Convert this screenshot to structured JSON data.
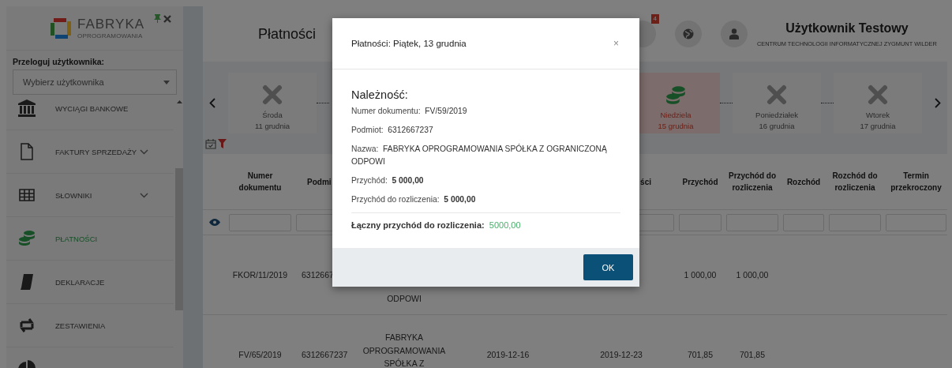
{
  "sidebar": {
    "logo": {
      "name": "FABRYKA",
      "tagline": "OPROGRAMOWANIA"
    },
    "switch_user": {
      "label": "Przeloguj użytkownika:",
      "placeholder": "Wybierz użytkownika"
    },
    "items": [
      {
        "kind": "bank",
        "label": "WYCIĄGI BANKOWE",
        "has_submenu": false,
        "selected": false
      },
      {
        "kind": "document",
        "label": "FAKTURY SPRZEDAŻY",
        "has_submenu": true,
        "selected": false
      },
      {
        "kind": "table",
        "label": "SŁOWNIKI",
        "has_submenu": true,
        "selected": false
      },
      {
        "kind": "coins",
        "label": "PŁATNOŚCI",
        "has_submenu": false,
        "selected": true
      },
      {
        "kind": "book",
        "label": "DEKLARACJE",
        "has_submenu": false,
        "selected": false
      },
      {
        "kind": "exchange",
        "label": "ZESTAWIENIA",
        "has_submenu": false,
        "selected": false
      },
      {
        "kind": "pie",
        "has_submenu": false,
        "selected": false
      }
    ]
  },
  "header": {
    "title": "Płatności",
    "notification_count": "4",
    "user_name": "Użytkownik Testowy",
    "company": "CENTRUM TECHNOLOGII INFORMATYCZNEJ ZYGMUNT WILDER"
  },
  "days": [
    {
      "kind": "empty",
      "day": "Środa",
      "date": "11 grudnia",
      "highlighted": false
    },
    {
      "kind": "payments",
      "day": "Niedziela",
      "date": "15 grudnia",
      "highlighted": true
    },
    {
      "kind": "empty",
      "day": "Poniedziałek",
      "date": "16 grudnia",
      "highlighted": false
    },
    {
      "kind": "empty",
      "day": "Wtorek",
      "date": "17 grudnia",
      "highlighted": false
    }
  ],
  "table": {
    "columns": [
      "Numer dokumentu",
      "Podmi",
      null,
      null,
      "ści",
      "Przychód",
      "Przychód do rozliczenia",
      "Rozchód",
      "Rozchód do rozliczenia",
      "Termin przekroczony"
    ],
    "rows": [
      [
        "FKOR/11/2019",
        "6312667",
        "ODPOWI",
        null,
        null,
        "1 000,00",
        "1 000,00",
        null,
        null,
        null
      ],
      [
        "FV/65/2019",
        "6312667237",
        "FABRYKA OPROGRAMOWANIA SPÓŁKA Z",
        "2019-12-16",
        "2019-12-23",
        "701,85",
        "701,85",
        null,
        null,
        null
      ]
    ]
  },
  "modal": {
    "title": "Płatności: Piątek, 13 grudnia",
    "close": "×",
    "heading": "Należność:",
    "fields": [
      {
        "label": "Numer dokumentu:",
        "value": "FV/59/2019",
        "bold": false
      },
      {
        "label": "Podmiot:",
        "value": "6312667237",
        "bold": false
      },
      {
        "label": "Nazwa:",
        "value": "FABRYKA OPROGRAMOWANIA SPÓŁKA Z OGRANICZONĄ ODPOWI",
        "bold": false
      },
      {
        "label": "Przychód:",
        "value": "5 000,00",
        "bold": true
      },
      {
        "label": "Przychód do rozliczenia:",
        "value": "5 000,00",
        "bold": true
      }
    ],
    "total": {
      "label": "Łączny przychód do rozliczenia:",
      "value": "5000,00"
    },
    "ok_button": "OK"
  }
}
